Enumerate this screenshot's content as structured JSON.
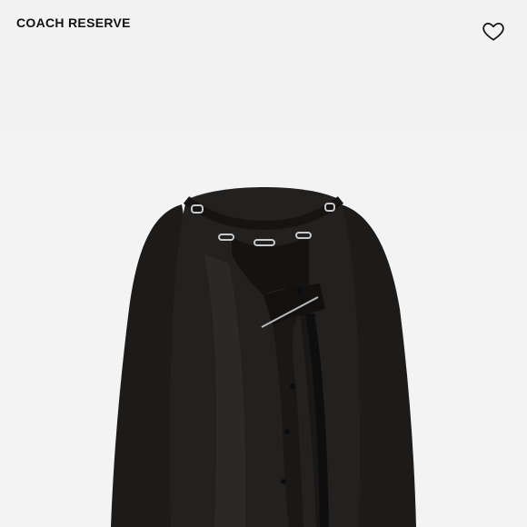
{
  "header": {
    "brand": "COACH RESERVE",
    "wishlist_icon": "heart-outline-icon"
  },
  "product": {
    "image_description_icon": "product-image"
  }
}
